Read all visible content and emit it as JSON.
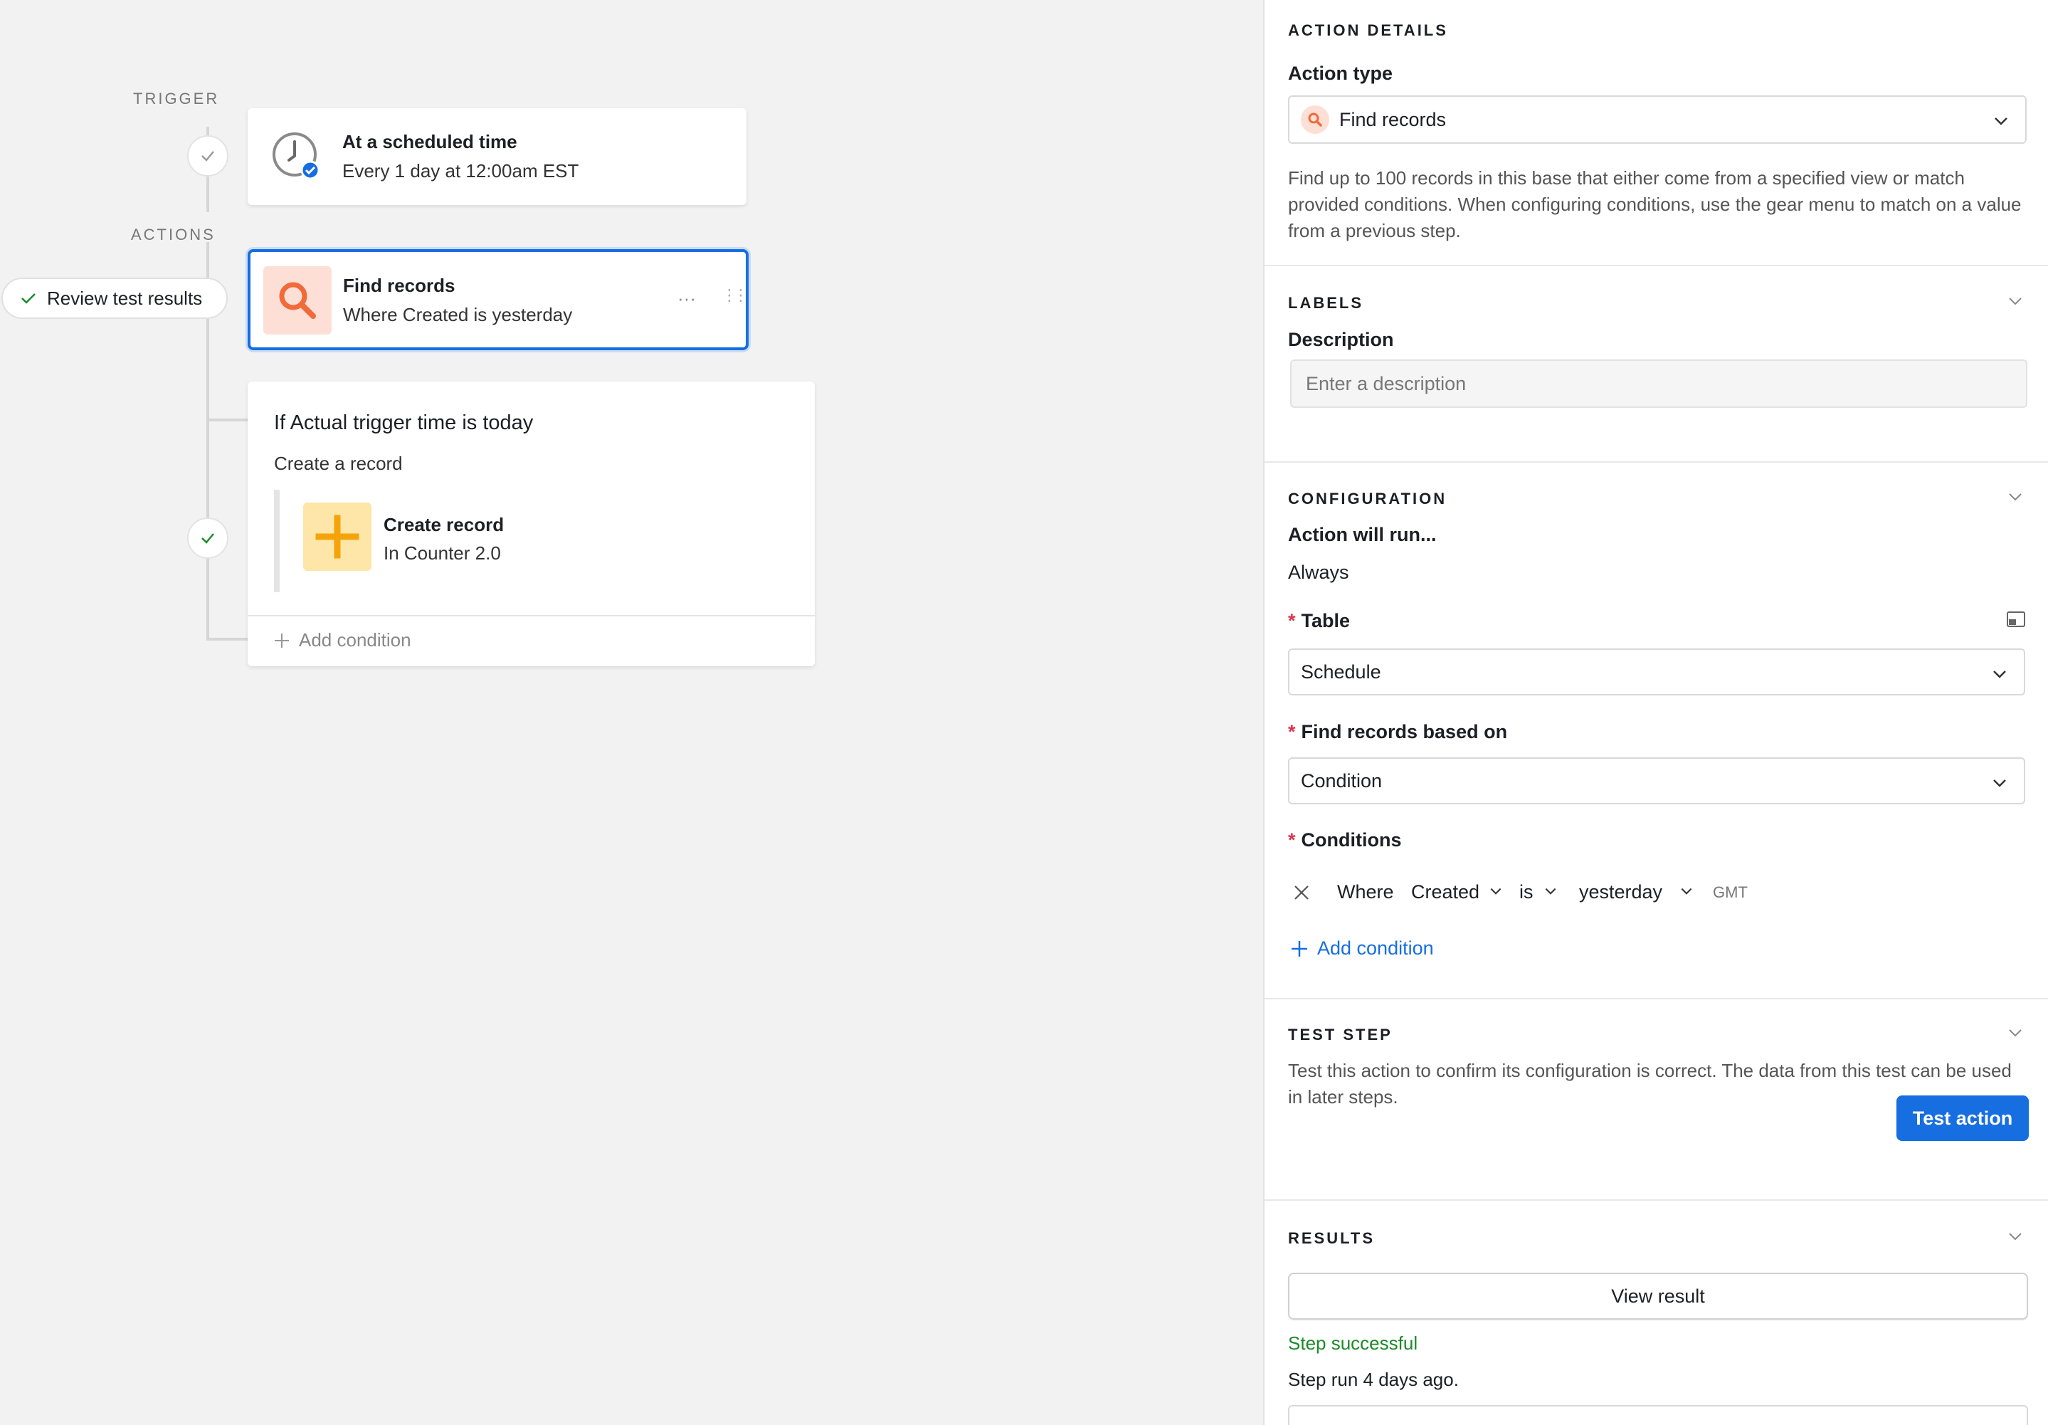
{
  "canvas": {
    "trigger_label": "TRIGGER",
    "actions_label": "ACTIONS",
    "review_label": "Review test results",
    "trigger_card": {
      "title": "At a scheduled time",
      "subtitle": "Every 1 day at 12:00am EST",
      "icon": "clock-icon"
    },
    "find_card": {
      "title": "Find records",
      "subtitle": "Where Created is yesterday",
      "icon": "search-icon",
      "more": "···",
      "drag": "⋮⋮"
    },
    "condition_card": {
      "title": "If Actual trigger time is today",
      "subtitle": "Create a record",
      "inner_title": "Create record",
      "inner_subtitle": "In Counter 2.0",
      "inner_icon": "plus-icon",
      "add_condition": "Add condition"
    }
  },
  "panel": {
    "action_details": {
      "heading": "ACTION DETAILS",
      "action_type_label": "Action type",
      "action_type_value": "Find records",
      "description": "Find up to 100 records in this base that either come from a specified view or match provided conditions. When configuring conditions, use the gear menu to match on a value from a previous step."
    },
    "labels": {
      "heading": "LABELS",
      "description_label": "Description",
      "description_placeholder": "Enter a description"
    },
    "configuration": {
      "heading": "CONFIGURATION",
      "run_label": "Action will run...",
      "run_value": "Always",
      "table_label": "Table",
      "table_value": "Schedule",
      "find_based_label": "Find records based on",
      "find_based_value": "Condition",
      "conditions_label": "Conditions",
      "condition": {
        "where": "Where",
        "field": "Created",
        "operator": "is",
        "value": "yesterday",
        "tz": "GMT"
      },
      "add_condition": "Add condition"
    },
    "test_step": {
      "heading": "TEST STEP",
      "description": "Test this action to confirm its configuration is correct. The data from this test can be used in later steps.",
      "button": "Test action"
    },
    "results": {
      "heading": "RESULTS",
      "view_button": "View result",
      "status": "Step successful",
      "run_time": "Step run 4 days ago."
    }
  },
  "colors": {
    "accent_blue": "#166ee1",
    "success_green": "#1b8a2a",
    "search_tile": "#fddfd6",
    "search_icon": "#f06a3a",
    "plus_tile": "#fde6a8",
    "plus_icon": "#f4a40a",
    "required": "#e0334d"
  }
}
